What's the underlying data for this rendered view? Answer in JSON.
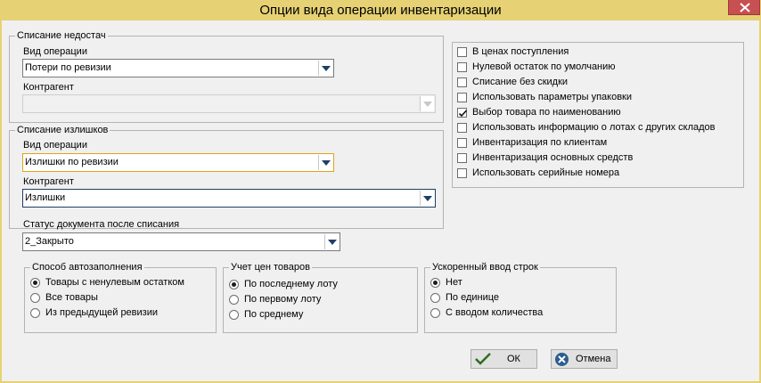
{
  "window": {
    "title": "Опции вида операции инвентаризации"
  },
  "shortage": {
    "legend": "Списание недостач",
    "op_label": "Вид операции",
    "op_value": "Потери по ревизии",
    "contractor_label": "Контрагент",
    "contractor_value": ""
  },
  "surplus": {
    "legend": "Списание излишков",
    "op_label": "Вид операции",
    "op_value": "Излишки по ревизии",
    "contractor_label": "Контрагент",
    "contractor_value": "Излишки"
  },
  "status": {
    "label": "Статус документа после списания",
    "value": "2_Закрыто"
  },
  "options": [
    {
      "label": "В ценах поступления",
      "checked": false
    },
    {
      "label": "Нулевой остаток по умолчанию",
      "checked": false
    },
    {
      "label": "Списание без скидки",
      "checked": false
    },
    {
      "label": "Использовать параметры упаковки",
      "checked": false
    },
    {
      "label": "Выбор товара по наименованию",
      "checked": true
    },
    {
      "label": "Использовать информацию о лотах с других складов",
      "checked": false
    },
    {
      "label": "Инвентаризация по клиентам",
      "checked": false
    },
    {
      "label": "Инвентаризация основных средств",
      "checked": false
    },
    {
      "label": "Использовать серийные номера",
      "checked": false
    }
  ],
  "autofill": {
    "legend": "Способ автозаполнения",
    "items": [
      "Товары с ненулевым остатком",
      "Все товары",
      "Из предыдущей ревизии"
    ],
    "selected": 0
  },
  "pricing": {
    "legend": "Учет цен товаров",
    "items": [
      "По последнему лоту",
      "По первому лоту",
      "По среднему"
    ],
    "selected": 0
  },
  "fastinput": {
    "legend": "Ускоренный ввод строк",
    "items": [
      "Нет",
      "По единице",
      "С вводом количества"
    ],
    "selected": 0
  },
  "buttons": {
    "ok": "ОК",
    "cancel": "Отмена"
  },
  "colors": {
    "titlebar": "#e6d274",
    "close": "#c75050",
    "focus": "#e3a21a",
    "ok_icon": "#2d6e1e",
    "cancel_icon": "#2b5d8f"
  }
}
